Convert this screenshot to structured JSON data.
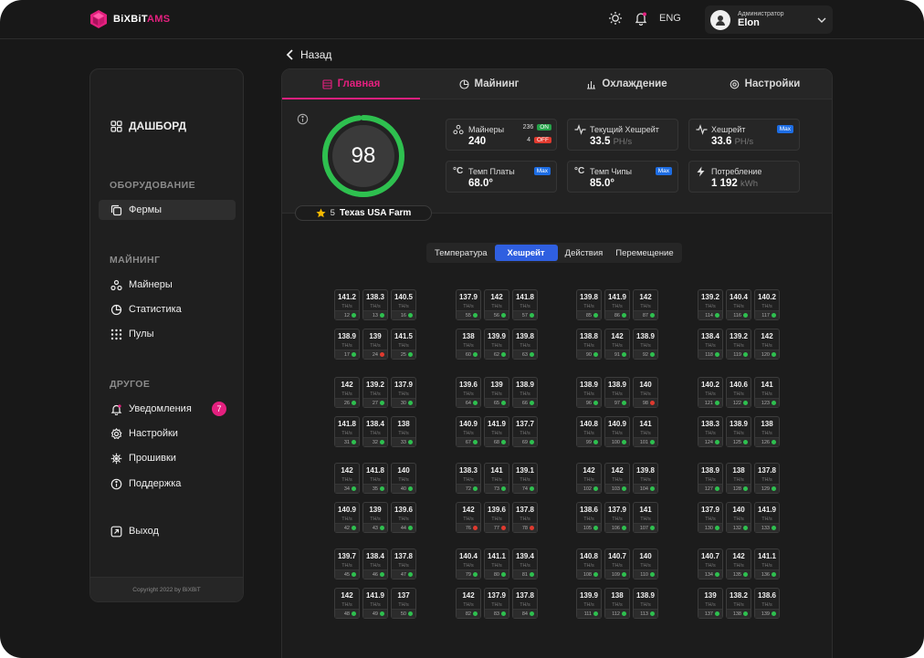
{
  "app": {
    "logo_main": "BiXBiT",
    "logo_suffix": "AMS",
    "language": "ENG",
    "user_role": "Администратор",
    "user_name": "Elon",
    "accent": "#e4207f"
  },
  "nav": {
    "back_label": "Назад",
    "dashboard_label": "ДАШБОРД",
    "section_equipment": "ОБОРУДОВАНИЕ",
    "farms_label": "Фермы",
    "section_mining": "МАЙНИНГ",
    "miners_label": "Майнеры",
    "stats_label": "Статистика",
    "pools_label": "Пулы",
    "section_other": "ДРУГОЕ",
    "notifications_label": "Уведомления",
    "notifications_count": "7",
    "settings_label": "Настройки",
    "firmware_label": "Прошивки",
    "support_label": "Поддержка",
    "logout_label": "Выход",
    "copyright": "Copyright 2022 by BiXBiT"
  },
  "tabs": [
    {
      "label": "Главная",
      "icon": "server-icon"
    },
    {
      "label": "Майнинг",
      "icon": "pie-chart-icon"
    },
    {
      "label": "Охлаждение",
      "icon": "bar-chart-icon"
    },
    {
      "label": "Настройки",
      "icon": "gear-icon"
    }
  ],
  "overview": {
    "score": "98",
    "score_fraction": 0.98,
    "rating": "5",
    "farm_name": "Texas USA Farm",
    "miners_label": "Майнеры",
    "miners_total": "240",
    "miners_on_count": "236",
    "miners_on_tag": "ON",
    "miners_off_count": "4",
    "miners_off_tag": "OFF",
    "cur_hash_label": "Текущий Хешрейт",
    "cur_hash_value": "33.5",
    "cur_hash_unit": "PH/s",
    "hash_label": "Хешрейт",
    "hash_value": "33.6",
    "hash_unit": "PH/s",
    "board_temp_label": "Темп Платы",
    "board_temp_value": "68.0°",
    "chip_temp_label": "Темп Чипы",
    "chip_temp_value": "85.0°",
    "power_label": "Потребление",
    "power_value": "1 192",
    "power_unit": "kWh",
    "max_tag": "Max"
  },
  "view_switch": {
    "temperature": "Температура",
    "hashrate": "Хешрейт",
    "actions": "Действия",
    "movement": "Перемещение"
  },
  "miner_unit": "TH/s",
  "miners": [
    [
      "141.2",
      "12",
      "g"
    ],
    [
      "138.3",
      "13",
      "g"
    ],
    [
      "140.5",
      "16",
      "g"
    ],
    [
      "137.9",
      "55",
      "g"
    ],
    [
      "142",
      "56",
      "g"
    ],
    [
      "141.8",
      "57",
      "g"
    ],
    [
      "139.8",
      "85",
      "g"
    ],
    [
      "141.9",
      "86",
      "g"
    ],
    [
      "142",
      "87",
      "g"
    ],
    [
      "139.2",
      "114",
      "g"
    ],
    [
      "140.4",
      "116",
      "g"
    ],
    [
      "140.2",
      "117",
      "g"
    ],
    [
      "138.9",
      "17",
      "g"
    ],
    [
      "139",
      "24",
      "r"
    ],
    [
      "141.5",
      "25",
      "g"
    ],
    [
      "138",
      "60",
      "g"
    ],
    [
      "139.9",
      "62",
      "g"
    ],
    [
      "139.8",
      "63",
      "g"
    ],
    [
      "138.8",
      "90",
      "g"
    ],
    [
      "142",
      "91",
      "g"
    ],
    [
      "138.9",
      "92",
      "g"
    ],
    [
      "138.4",
      "118",
      "g"
    ],
    [
      "139.2",
      "119",
      "g"
    ],
    [
      "142",
      "120",
      "g"
    ],
    [
      "142",
      "26",
      "g"
    ],
    [
      "139.2",
      "27",
      "g"
    ],
    [
      "137.9",
      "30",
      "g"
    ],
    [
      "139.6",
      "64",
      "g"
    ],
    [
      "139",
      "65",
      "g"
    ],
    [
      "138.9",
      "66",
      "g"
    ],
    [
      "138.9",
      "96",
      "g"
    ],
    [
      "138.9",
      "97",
      "g"
    ],
    [
      "140",
      "98",
      "r"
    ],
    [
      "140.2",
      "121",
      "g"
    ],
    [
      "140.6",
      "122",
      "g"
    ],
    [
      "141",
      "123",
      "g"
    ],
    [
      "141.8",
      "31",
      "g"
    ],
    [
      "138.4",
      "32",
      "g"
    ],
    [
      "138",
      "33",
      "g"
    ],
    [
      "140.9",
      "67",
      "g"
    ],
    [
      "141.9",
      "68",
      "g"
    ],
    [
      "137.7",
      "69",
      "g"
    ],
    [
      "140.8",
      "99",
      "g"
    ],
    [
      "140.9",
      "100",
      "g"
    ],
    [
      "141",
      "101",
      "g"
    ],
    [
      "138.3",
      "124",
      "g"
    ],
    [
      "138.9",
      "125",
      "g"
    ],
    [
      "138",
      "126",
      "g"
    ],
    [
      "142",
      "34",
      "g"
    ],
    [
      "141.8",
      "35",
      "g"
    ],
    [
      "140",
      "40",
      "g"
    ],
    [
      "138.3",
      "72",
      "g"
    ],
    [
      "141",
      "73",
      "g"
    ],
    [
      "139.1",
      "74",
      "g"
    ],
    [
      "142",
      "102",
      "g"
    ],
    [
      "142",
      "103",
      "g"
    ],
    [
      "139.8",
      "104",
      "g"
    ],
    [
      "138.9",
      "127",
      "g"
    ],
    [
      "138",
      "128",
      "g"
    ],
    [
      "137.8",
      "129",
      "g"
    ],
    [
      "140.9",
      "42",
      "g"
    ],
    [
      "139",
      "43",
      "g"
    ],
    [
      "139.6",
      "44",
      "g"
    ],
    [
      "142",
      "76",
      "r"
    ],
    [
      "139.6",
      "77",
      "r"
    ],
    [
      "137.8",
      "78",
      "r"
    ],
    [
      "138.6",
      "105",
      "g"
    ],
    [
      "137.9",
      "106",
      "g"
    ],
    [
      "141",
      "107",
      "g"
    ],
    [
      "137.9",
      "130",
      "g"
    ],
    [
      "140",
      "132",
      "g"
    ],
    [
      "141.9",
      "133",
      "g"
    ],
    [
      "139.7",
      "45",
      "g"
    ],
    [
      "138.4",
      "46",
      "g"
    ],
    [
      "137.8",
      "47",
      "g"
    ],
    [
      "140.4",
      "79",
      "g"
    ],
    [
      "141.1",
      "80",
      "g"
    ],
    [
      "139.4",
      "81",
      "g"
    ],
    [
      "140.8",
      "108",
      "g"
    ],
    [
      "140.7",
      "109",
      "g"
    ],
    [
      "140",
      "110",
      "g"
    ],
    [
      "140.7",
      "134",
      "g"
    ],
    [
      "142",
      "135",
      "g"
    ],
    [
      "141.1",
      "136",
      "g"
    ],
    [
      "142",
      "48",
      "g"
    ],
    [
      "141.9",
      "49",
      "g"
    ],
    [
      "137",
      "50",
      "g"
    ],
    [
      "142",
      "82",
      "g"
    ],
    [
      "137.9",
      "83",
      "g"
    ],
    [
      "137.8",
      "84",
      "g"
    ],
    [
      "139.9",
      "111",
      "g"
    ],
    [
      "138",
      "112",
      "g"
    ],
    [
      "138.9",
      "113",
      "g"
    ],
    [
      "139",
      "137",
      "g"
    ],
    [
      "138.2",
      "138",
      "g"
    ],
    [
      "138.6",
      "139",
      "g"
    ]
  ],
  "status_colors": {
    "ok": "#2ec04f",
    "error": "#e03a2f"
  }
}
